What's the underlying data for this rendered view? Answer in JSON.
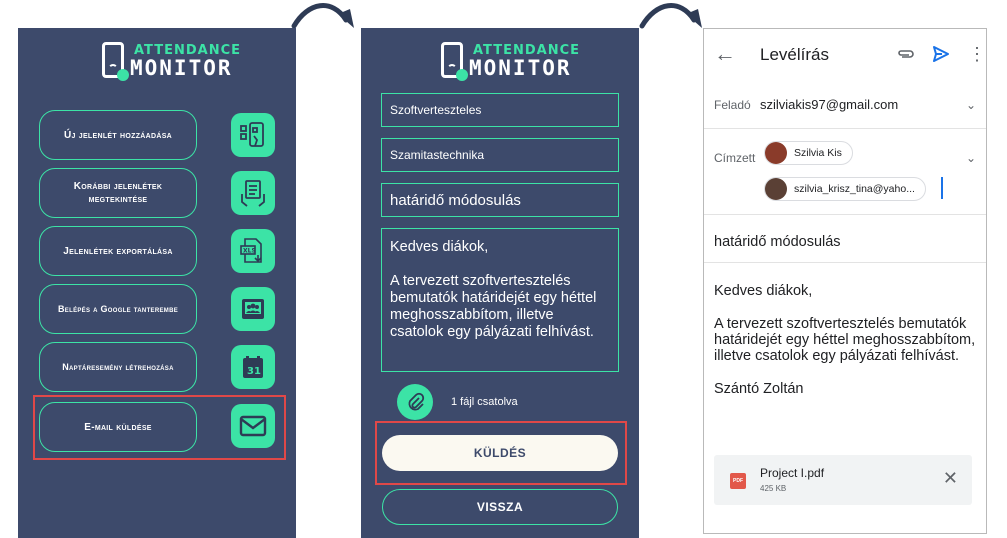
{
  "logo": {
    "line1": "ATTENDANCE",
    "line2": "MONITOR",
    "accent_color": "#3ce3a6",
    "panel_color": "#3d4a6b"
  },
  "menu": {
    "items": [
      {
        "label": "Új jelenlét hozzáadása",
        "icon": "qr-phone-icon"
      },
      {
        "label": "Korábbi jelenlétek megtekintése",
        "icon": "clipboard-hand-icon"
      },
      {
        "label": "Jelenlétek exportálása",
        "icon": "xls-export-icon"
      },
      {
        "label": "Belépés a Google tanterembe",
        "icon": "classroom-icon"
      },
      {
        "label": "Naptáresemény létrehozása",
        "icon": "calendar-icon",
        "icon_text": "31"
      },
      {
        "label": "E-mail küldése",
        "icon": "mail-icon"
      }
    ]
  },
  "form": {
    "field1": "Szoftverteszteles",
    "field2": "Szamitastechnika",
    "subject": "határidő módosulás",
    "message": [
      "Kedves diákok,",
      "A tervezett szoftvertesztelés bemutatók határidejét egy héttel meghosszabbítom, illetve csatolok egy pályázati felhívást."
    ],
    "attachment_text": "1 fájl csatolva",
    "send_label": "KÜLDÉS",
    "back_label": "VISSZA"
  },
  "gmail": {
    "title": "Levélírás",
    "from_label": "Feladó",
    "from_value": "szilviakis97@gmail.com",
    "to_label": "Címzett",
    "recipients": [
      "Szilvia Kis",
      "szilvia_krisz_tina@yaho..."
    ],
    "subject": "határidő módosulás",
    "body": [
      "Kedves diákok,",
      "A tervezett szoftvertesztelés bemutatók határidejét egy héttel meghosszabbítom, illetve csatolok egy pályázati felhívást.",
      "Szántó Zoltán"
    ],
    "attachment": {
      "name": "Project I.pdf",
      "size": "425 KB",
      "icon_text": "PDF"
    },
    "send_color": "#1a73e8"
  }
}
